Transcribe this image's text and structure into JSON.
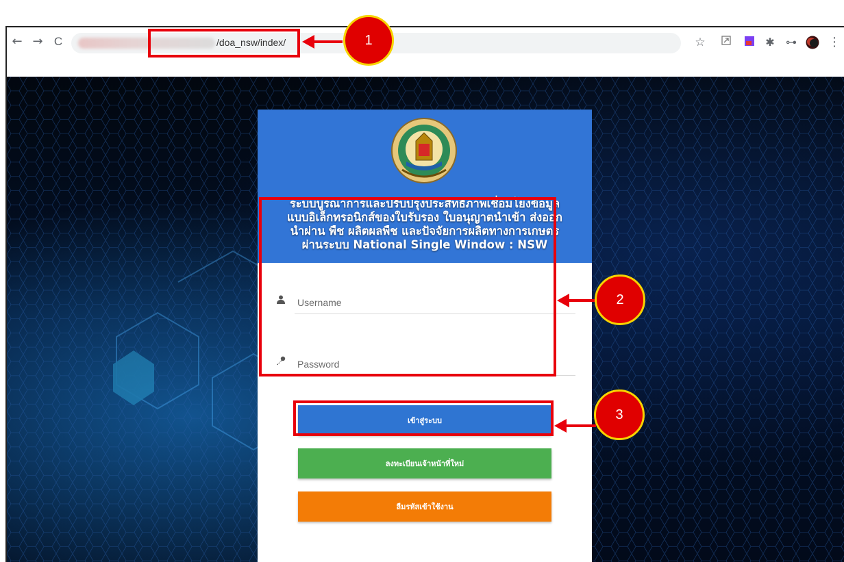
{
  "browser": {
    "url_text": "/doa_nsw/index/",
    "nav": {
      "back": "←",
      "forward": "→",
      "reload": "C"
    },
    "toolbar_icons": [
      "star-icon",
      "screenshot-icon",
      "extension-rp-icon",
      "puzzle-icon",
      "key-icon",
      "profile-avatar",
      "menu-dots-icon"
    ],
    "toolbar_glyphs": {
      "star": "☆",
      "menu": "⋮",
      "key": "⊶",
      "puzzle": "✱"
    }
  },
  "login": {
    "title_lines": [
      "ระบบบูรณาการและปรับปรุงประสิทธิภาพเชื่อมโยงข้อมูล",
      "แบบอิเล็กทรอนิกส์ของใบรับรอง ใบอนุญาตนำเข้า ส่งออก",
      "นำผ่าน พืช ผลิตผลพืช และปัจจัยการผลิตทางการเกษตร",
      "ผ่านระบบ National Single Window : NSW"
    ],
    "username_placeholder": "Username",
    "password_placeholder": "Password",
    "login_button": "เข้าสู่ระบบ",
    "register_button": "ลงทะเบียนเจ้าหน้าที่ใหม่",
    "forgot_button": "ลืมรหัสเข้าใช้งาน"
  },
  "annotations": {
    "callout_1": "1",
    "callout_2": "2",
    "callout_3": "3"
  },
  "colors": {
    "header_blue": "#3275d6",
    "login_blue": "#2f75d2",
    "register_green": "#4caf50",
    "forgot_orange": "#f37c06",
    "highlight_red": "#e8000b",
    "callout_yellow": "#f7d300"
  }
}
